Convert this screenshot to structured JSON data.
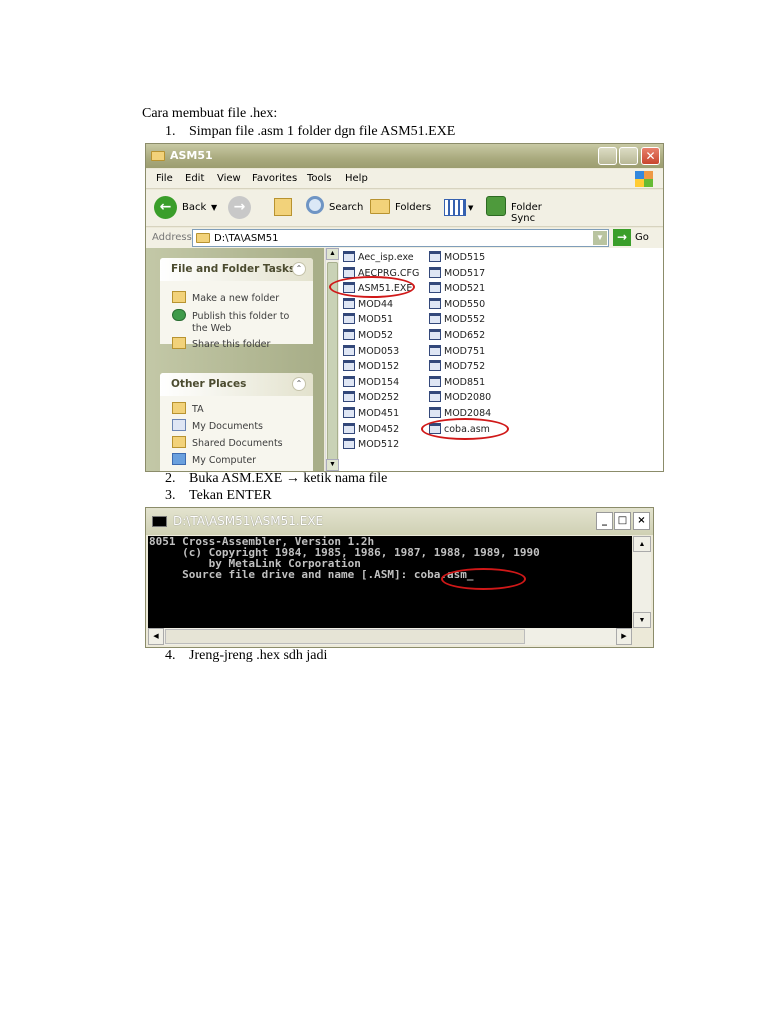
{
  "doc": {
    "heading": "Cara membuat file .hex:",
    "steps": [
      {
        "num": "1.",
        "text": "Simpan file .asm 1 folder dgn file ASM51.EXE"
      },
      {
        "num": "2.",
        "text": "Buka ASM.EXE → ketik nama file"
      },
      {
        "num": "3.",
        "text": "Tekan ENTER"
      },
      {
        "num": "4.",
        "text": "Jreng-jreng .hex sdh jadi"
      }
    ]
  },
  "explorer": {
    "title": "ASM51",
    "menu": [
      "File",
      "Edit",
      "View",
      "Favorites",
      "Tools",
      "Help"
    ],
    "toolbar": {
      "back": "Back",
      "search": "Search",
      "folders": "Folders",
      "folder_sync": "Folder Sync"
    },
    "address_label": "Address",
    "address": "D:\\TA\\ASM51",
    "go": "Go",
    "tasks": {
      "title": "File and Folder Tasks",
      "items": [
        "Make a new folder",
        "Publish this folder to",
        "the Web",
        "Share this folder"
      ]
    },
    "places": {
      "title": "Other Places",
      "items": [
        "TA",
        "My Documents",
        "Shared Documents",
        "My Computer"
      ]
    },
    "files_col1": [
      "Aec_isp.exe",
      "AECPRG.CFG",
      "ASM51.EXE",
      "MOD44",
      "MOD51",
      "MOD52",
      "MOD053",
      "MOD152",
      "MOD154",
      "MOD252",
      "MOD451",
      "MOD452",
      "MOD512"
    ],
    "files_col2": [
      "MOD515",
      "MOD517",
      "MOD521",
      "MOD550",
      "MOD552",
      "MOD652",
      "MOD751",
      "MOD752",
      "MOD851",
      "MOD2080",
      "MOD2084",
      "coba.asm"
    ]
  },
  "console": {
    "title": "D:\\TA\\ASM51\\ASM51.EXE",
    "lines": [
      "8051 Cross-Assembler, Version 1.2h",
      "     (c) Copyright 1984, 1985, 1986, 1987, 1988, 1989, 1990",
      "         by MetaLink Corporation",
      "     Source file drive and name [.ASM]: "
    ],
    "input": "coba.asm"
  }
}
